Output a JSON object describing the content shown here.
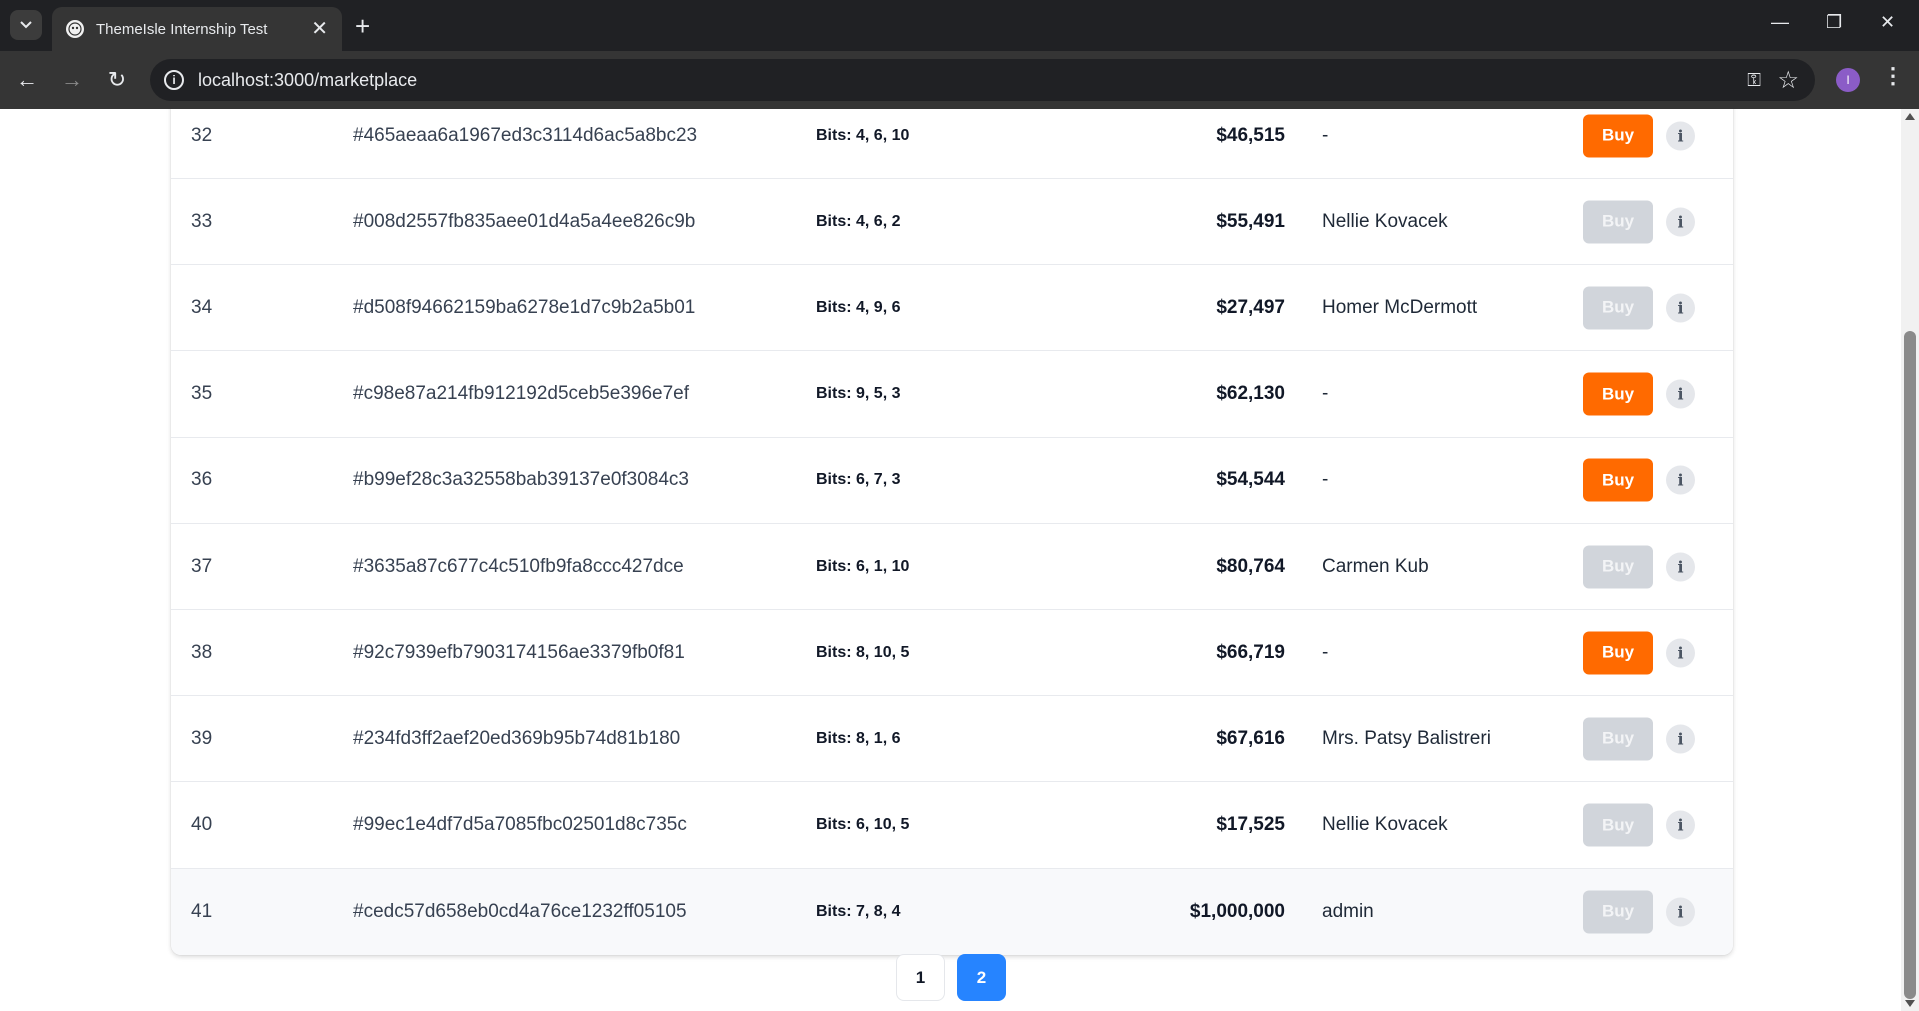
{
  "browser": {
    "tab_title": "ThemeIsle Internship Test",
    "url": "localhost:3000/marketplace",
    "profile_initial": "I"
  },
  "rows": [
    {
      "id": "32",
      "hash": "#465aeaa6a1967ed3c3114d6ac5a8bc23",
      "bits": "Bits: 4, 6, 10",
      "price": "$46,515",
      "owner": "-",
      "buy_label": "Buy",
      "buy_enabled": true
    },
    {
      "id": "33",
      "hash": "#008d2557fb835aee01d4a5a4ee826c9b",
      "bits": "Bits: 4, 6, 2",
      "price": "$55,491",
      "owner": "Nellie Kovacek",
      "buy_label": "Buy",
      "buy_enabled": false
    },
    {
      "id": "34",
      "hash": "#d508f94662159ba6278e1d7c9b2a5b01",
      "bits": "Bits: 4, 9, 6",
      "price": "$27,497",
      "owner": "Homer McDermott",
      "buy_label": "Buy",
      "buy_enabled": false
    },
    {
      "id": "35",
      "hash": "#c98e87a214fb912192d5ceb5e396e7ef",
      "bits": "Bits: 9, 5, 3",
      "price": "$62,130",
      "owner": "-",
      "buy_label": "Buy",
      "buy_enabled": true
    },
    {
      "id": "36",
      "hash": "#b99ef28c3a32558bab39137e0f3084c3",
      "bits": "Bits: 6, 7, 3",
      "price": "$54,544",
      "owner": "-",
      "buy_label": "Buy",
      "buy_enabled": true
    },
    {
      "id": "37",
      "hash": "#3635a87c677c4c510fb9fa8ccc427dce",
      "bits": "Bits: 6, 1, 10",
      "price": "$80,764",
      "owner": "Carmen Kub",
      "buy_label": "Buy",
      "buy_enabled": false
    },
    {
      "id": "38",
      "hash": "#92c7939efb7903174156ae3379fb0f81",
      "bits": "Bits: 8, 10, 5",
      "price": "$66,719",
      "owner": "-",
      "buy_label": "Buy",
      "buy_enabled": true
    },
    {
      "id": "39",
      "hash": "#234fd3ff2aef20ed369b95b74d81b180",
      "bits": "Bits: 8, 1, 6",
      "price": "$67,616",
      "owner": "Mrs. Patsy Balistreri",
      "buy_label": "Buy",
      "buy_enabled": false
    },
    {
      "id": "40",
      "hash": "#99ec1e4df7d5a7085fbc02501d8c735c",
      "bits": "Bits: 6, 10, 5",
      "price": "$17,525",
      "owner": "Nellie Kovacek",
      "buy_label": "Buy",
      "buy_enabled": false
    },
    {
      "id": "41",
      "hash": "#cedc57d658eb0cd4a76ce1232ff05105",
      "bits": "Bits: 7, 8, 4",
      "price": "$1,000,000",
      "owner": "admin",
      "buy_label": "Buy",
      "buy_enabled": false
    }
  ],
  "info_glyph": "i",
  "pagination": {
    "pages": [
      "1",
      "2"
    ],
    "current": "2"
  },
  "colors": {
    "buy_active": "#ff6a00",
    "buy_disabled": "#d1d5db",
    "page_active": "#2684ff"
  }
}
